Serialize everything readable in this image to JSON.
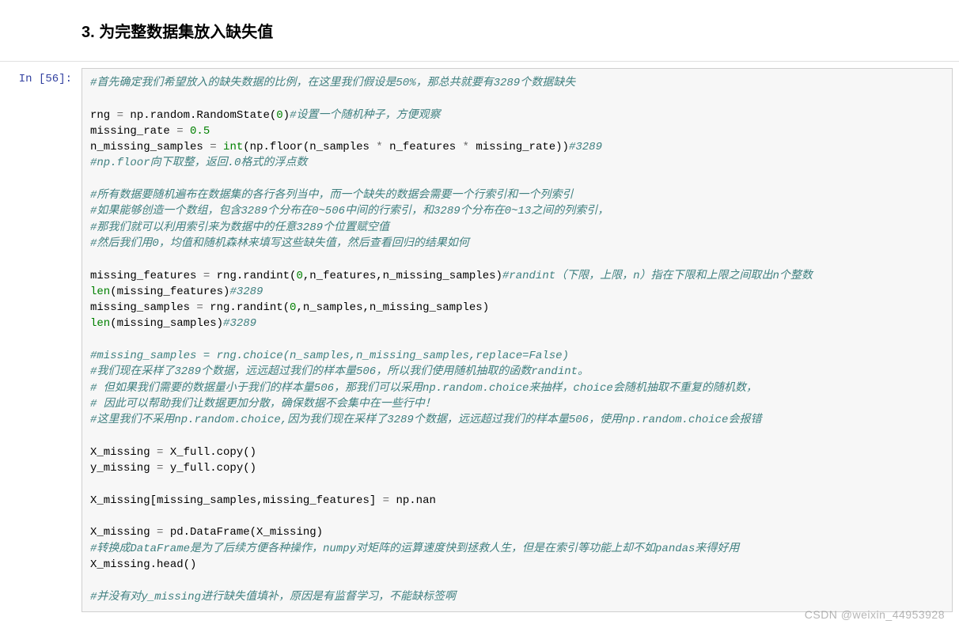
{
  "heading": "3. 为完整数据集放入缺失值",
  "prompt": "In  [56]:",
  "watermark": "CSDN @weixin_44953928",
  "code": {
    "l1": "#首先确定我们希望放入的缺失数据的比例，在这里我们假设是50%，那总共就要有3289个数据缺失",
    "l2_a": "rng ",
    "l2_b": "=",
    "l2_c": " np.random.RandomState(",
    "l2_d": "0",
    "l2_e": ")",
    "l2_f": "#设置一个随机种子，方便观察",
    "l3_a": "missing_rate ",
    "l3_b": "=",
    "l3_c": " ",
    "l3_d": "0.5",
    "l4_a": "n_missing_samples ",
    "l4_b": "=",
    "l4_c": " ",
    "l4_d": "int",
    "l4_e": "(np.floor(n_samples ",
    "l4_f": "*",
    "l4_g": " n_features ",
    "l4_h": "*",
    "l4_i": " missing_rate))",
    "l4_j": "#3289",
    "l5": "#np.floor向下取整，返回.0格式的浮点数",
    "l6": "#所有数据要随机遍布在数据集的各行各列当中，而一个缺失的数据会需要一个行索引和一个列索引",
    "l7": "#如果能够创造一个数组，包含3289个分布在0~506中间的行索引，和3289个分布在0~13之间的列索引，",
    "l8": "#那我们就可以利用索引来为数据中的任意3289个位置赋空值",
    "l9": "#然后我们用0，均值和随机森林来填写这些缺失值，然后查看回归的结果如何",
    "l10_a": "missing_features ",
    "l10_b": "=",
    "l10_c": " rng.randint(",
    "l10_d": "0",
    "l10_e": ",n_features,n_missing_samples)",
    "l10_f": "#randint（下限，上限，n）指在下限和上限之间取出n个整数",
    "l11_a": "len",
    "l11_b": "(missing_features)",
    "l11_c": "#3289",
    "l12_a": "missing_samples ",
    "l12_b": "=",
    "l12_c": " rng.randint(",
    "l12_d": "0",
    "l12_e": ",n_samples,n_missing_samples)",
    "l13_a": "len",
    "l13_b": "(missing_samples)",
    "l13_c": "#3289",
    "l14": "#missing_samples = rng.choice(n_samples,n_missing_samples,replace=False)",
    "l15": "#我们现在采样了3289个数据，远远超过我们的样本量506，所以我们使用随机抽取的函数randint。",
    "l16": "# 但如果我们需要的数据量小于我们的样本量506，那我们可以采用np.random.choice来抽样，choice会随机抽取不重复的随机数，",
    "l17": "# 因此可以帮助我们让数据更加分散，确保数据不会集中在一些行中！",
    "l18": "#这里我们不采用np.random.choice,因为我们现在采样了3289个数据，远远超过我们的样本量506，使用np.random.choice会报错",
    "l19_a": "X_missing ",
    "l19_b": "=",
    "l19_c": " X_full.copy()",
    "l20_a": "y_missing ",
    "l20_b": "=",
    "l20_c": " y_full.copy()",
    "l21_a": "X_missing[missing_samples,missing_features] ",
    "l21_b": "=",
    "l21_c": " np.nan",
    "l22_a": "X_missing ",
    "l22_b": "=",
    "l22_c": " pd.DataFrame(X_missing)",
    "l23": "#转换成DataFrame是为了后续方便各种操作，numpy对矩阵的运算速度快到拯救人生，但是在索引等功能上却不如pandas来得好用",
    "l24": "X_missing.head()",
    "l25": "#并没有对y_missing进行缺失值填补，原因是有监督学习，不能缺标签啊"
  }
}
